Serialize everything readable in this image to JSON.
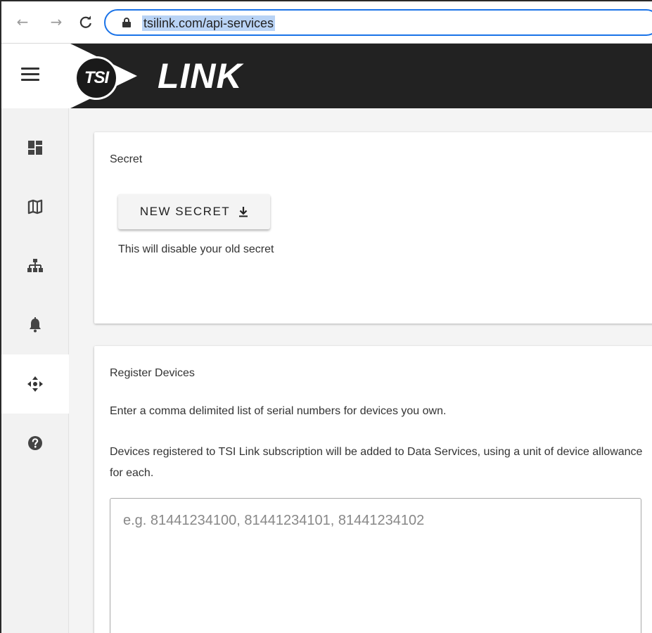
{
  "browser": {
    "back_glyph": "←",
    "forward_glyph": "→",
    "reload_glyph": "C",
    "url": "tsilink.com/api-services"
  },
  "header": {
    "logo_badge": "TSI",
    "logo_text": "LINK",
    "background_color": "#222222"
  },
  "sidebar": {
    "items": [
      {
        "icon": "dashboard-icon"
      },
      {
        "icon": "map-icon"
      },
      {
        "icon": "sitemap-icon"
      },
      {
        "icon": "bell-icon"
      },
      {
        "icon": "arrows-move-icon",
        "active": true
      },
      {
        "icon": "help-icon"
      }
    ]
  },
  "secret_card": {
    "title": "Secret",
    "button_label": "NEW SECRET",
    "note": "This will disable your old secret"
  },
  "register_card": {
    "title": "Register Devices",
    "instructions": "Enter a comma delimited list of serial numbers for devices you own.",
    "details": "Devices registered to TSI Link subscription will be added to Data Services, using a unit of device allowance for each.",
    "input_value": "",
    "input_placeholder": "e.g. 81441234100, 81441234101, 81441234102"
  }
}
